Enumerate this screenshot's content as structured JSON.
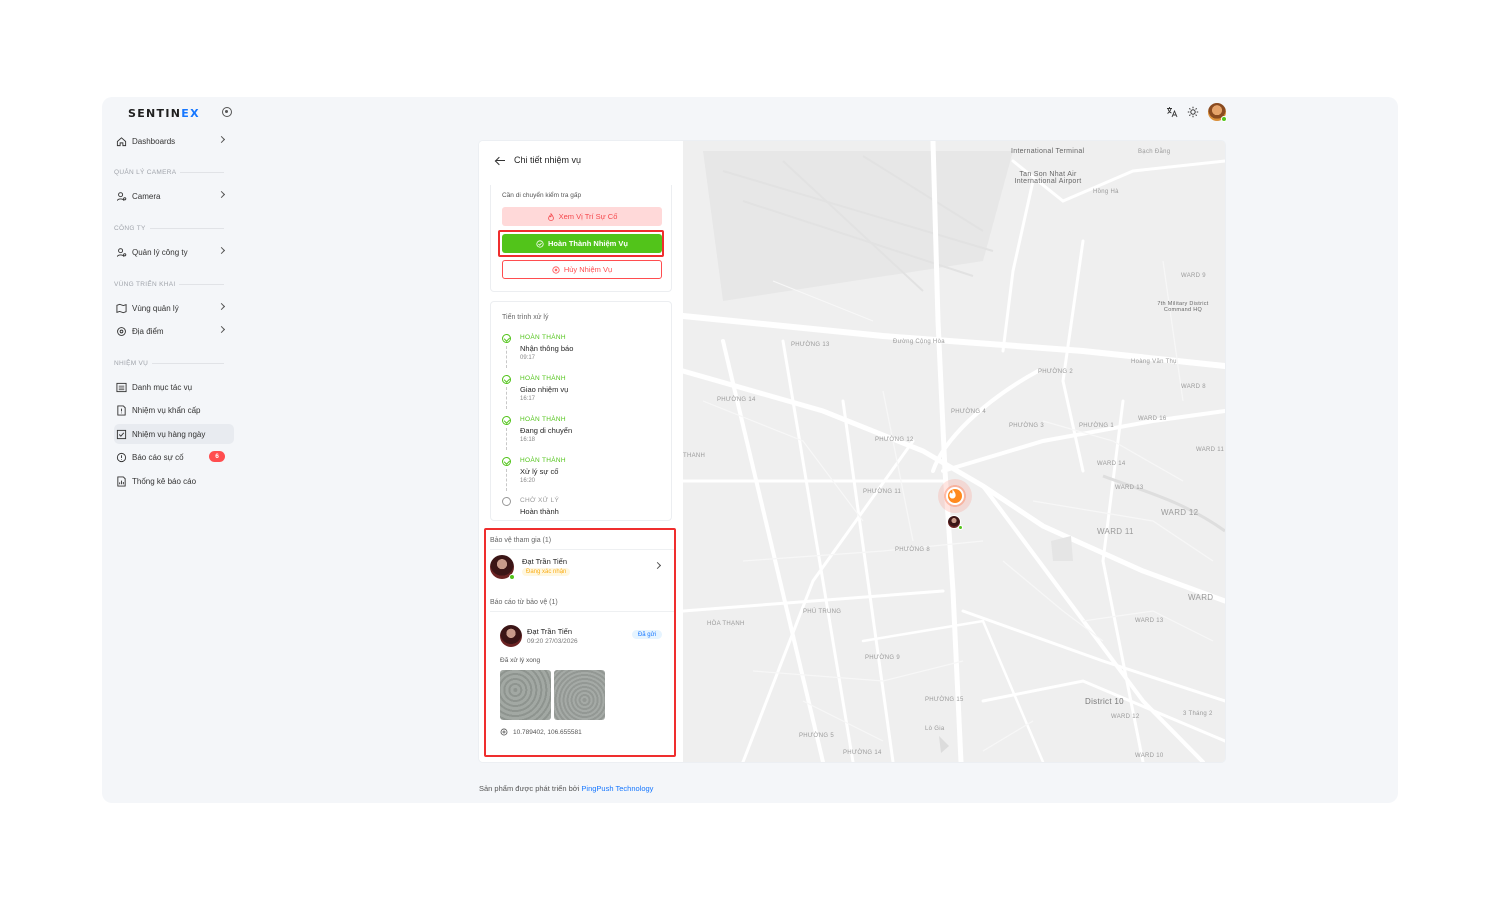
{
  "app": {
    "logo_main": "SENTIN",
    "logo_accent": "EX"
  },
  "sidebar": {
    "items": [
      {
        "label": "Dashboards"
      },
      {
        "label": "Camera"
      },
      {
        "label": "Quản lý công ty"
      },
      {
        "label": "Vùng quản lý"
      },
      {
        "label": "Địa điểm"
      },
      {
        "label": "Danh mục tác vụ"
      },
      {
        "label": "Nhiệm vụ khẩn cấp"
      },
      {
        "label": "Nhiệm vụ hàng ngày"
      },
      {
        "label": "Báo cáo sự cố",
        "badge": "6"
      },
      {
        "label": "Thống kê báo cáo"
      }
    ],
    "sections": [
      "QUẢN LÝ CAMERA",
      "CÔNG TY",
      "VÙNG TRIỂN KHAI",
      "NHIỆM VỤ"
    ],
    "active_item": "Nhiệm vụ hàng ngày"
  },
  "panel": {
    "title": "Chi tiết nhiệm vụ",
    "urgent_text": "Cần di chuyển kiểm tra gấp",
    "buttons": {
      "view_location": "Xem Vị Trí Sự Cố",
      "complete": "Hoàn Thành Nhiệm Vụ",
      "cancel": "Hủy Nhiệm Vụ"
    },
    "progress": {
      "title": "Tiến trình xử lý",
      "steps": [
        {
          "status": "HOÀN THÀNH",
          "name": "Nhận thông báo",
          "time": "09:17"
        },
        {
          "status": "HOÀN THÀNH",
          "name": "Giao nhiệm vụ",
          "time": "16:17"
        },
        {
          "status": "HOÀN THÀNH",
          "name": "Đang di chuyển",
          "time": "16:18"
        },
        {
          "status": "HOÀN THÀNH",
          "name": "Xử lý sự cố",
          "time": "16:20"
        },
        {
          "status": "CHỜ XỬ LÝ",
          "name": "Hoàn thành",
          "time": ""
        }
      ]
    },
    "guards": {
      "title": "Bảo vệ tham gia (1)",
      "name": "Đạt Trần Tiến",
      "status": "Đang xác nhận"
    },
    "reports": {
      "title": "Báo cáo từ bảo vệ (1)",
      "name": "Đạt Trần Tiến",
      "time": "09:20 27/03/2026",
      "tag": "Đã gửi",
      "text": "Đã xử lý xong",
      "coords": "10.789402, 106.655581"
    }
  },
  "map": {
    "labels": {
      "airport": "Tan Son Nhat Air International Airport",
      "international_terminal": "International Terminal",
      "district10": "District 10",
      "ward11": "WARD 11",
      "ward12": "WARD 12",
      "ward12b": "WARD 12",
      "ward10": "WARD 10",
      "ward9": "WARD 9",
      "ward8": "WARD 8",
      "ward16": "WARD 16",
      "ward14": "WARD 14",
      "ward13": "WARD 13",
      "ward13b": "WARD 13",
      "ward11b": "WARD 11",
      "ward_right": "WARD",
      "p13": "PHƯỜNG 13",
      "p14": "PHƯỜNG 14",
      "p12": "PHƯỜNG 12",
      "p11": "PHƯỜNG 11",
      "p8": "PHƯỜNG 8",
      "p9": "PHƯỜNG 9",
      "p15": "PHƯỜNG 15",
      "p5": "PHƯỜNG 5",
      "p14b": "PHƯỜNG 14",
      "p2": "PHƯỜNG 2",
      "p3": "PHƯỜNG 3",
      "p1": "PHƯỜNG 1",
      "p4": "PHƯỜNG 4",
      "phutrung": "PHÚ TRUNG",
      "hoathanh": "HÒA THẠNH",
      "cong_hoa": "Đường Cộng Hòa",
      "hoang_van_thu": "Hoàng Văn Thụ",
      "nguyen_van_troi": "Đường Nguyễn Văn Trỗi",
      "ba_thang_hai": "3 Tháng 2",
      "ly_thuong_kiet": "Lý Thường Kiệt",
      "thanh": "THANH",
      "lo_gia": "Lò Gia",
      "mil": "7th Military District Command HQ",
      "hong_ha": "Hồng Hà",
      "bach_dang": "Bạch Đằng",
      "ward_9_top": "WARD 9"
    }
  },
  "footer": {
    "text": "Sản phẩm được phát triển bởi ",
    "link": "PingPush Technology"
  }
}
